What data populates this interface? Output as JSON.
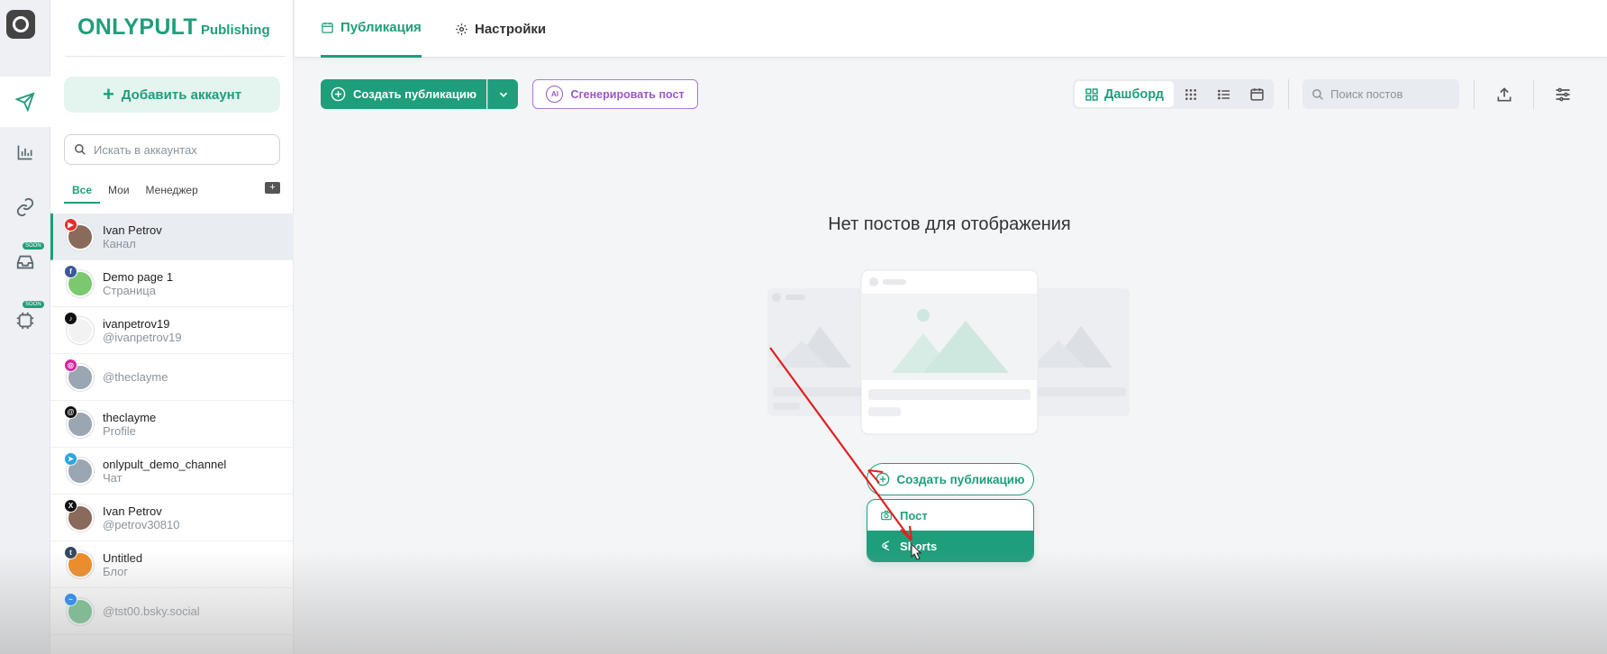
{
  "brand": {
    "name": "ONLYPULT",
    "product": "Publishing"
  },
  "rail": {
    "items": [
      {
        "icon": "instagram-logo-icon"
      },
      {
        "icon": "send-icon",
        "active": true
      },
      {
        "icon": "chart-icon"
      },
      {
        "icon": "link-icon"
      },
      {
        "icon": "inbox-icon",
        "badge": "SOON"
      },
      {
        "icon": "ai-chip-icon",
        "badge": "SOON"
      }
    ]
  },
  "sidebar": {
    "add_account": "Добавить аккаунт",
    "search_placeholder": "Искать в аккаунтах",
    "filters": [
      "Все",
      "Мои",
      "Менеджер"
    ],
    "accounts": [
      {
        "name": "Ivan Petrov",
        "sub": "Канал",
        "network": "youtube",
        "color": "#e52d27",
        "selected": true
      },
      {
        "name": "Demo page 1",
        "sub": "Страница",
        "network": "facebook",
        "color": "#3b5998"
      },
      {
        "name": "ivanpetrov19",
        "sub": "@ivanpetrov19",
        "network": "tiktok",
        "color": "#111111"
      },
      {
        "name": "",
        "sub": "@theclayme",
        "network": "instagram",
        "color": "#d6249f"
      },
      {
        "name": "theclayme",
        "sub": "Profile",
        "network": "threads",
        "color": "#111111"
      },
      {
        "name": "onlypult_demo_channel",
        "sub": "Чат",
        "network": "telegram",
        "color": "#2ca5e0"
      },
      {
        "name": "Ivan Petrov",
        "sub": "@petrov30810",
        "network": "x",
        "color": "#111111"
      },
      {
        "name": "Untitled",
        "sub": "Блог",
        "network": "tumblr",
        "color": "#35465c"
      },
      {
        "name": "",
        "sub": "@tst00.bsky.social",
        "network": "bluesky",
        "color": "#1185fe"
      }
    ]
  },
  "header": {
    "tabs": [
      {
        "label": "Публикация",
        "active": true
      },
      {
        "label": "Настройки",
        "active": false
      }
    ]
  },
  "toolbar": {
    "create_label": "Создать публикацию",
    "generate_label": "Сгенерировать пост",
    "view_dashboard": "Дашборд",
    "search_placeholder": "Поиск постов"
  },
  "empty_state": {
    "title": "Нет постов для отображения",
    "cta_label": "Создать публикацию",
    "menu": [
      {
        "label": "Пост",
        "icon": "camera-icon"
      },
      {
        "label": "Shorts",
        "icon": "shorts-icon",
        "highlighted": true
      }
    ]
  },
  "colors": {
    "accent": "#1f9e7b",
    "ai": "#9a58c4",
    "annotation": "#e02020"
  }
}
